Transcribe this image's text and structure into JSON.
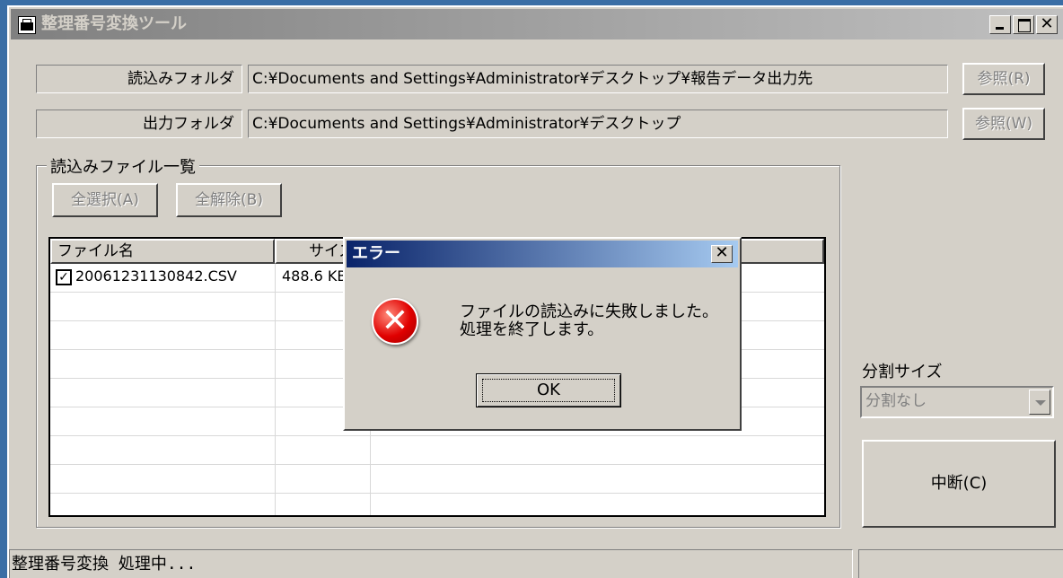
{
  "window": {
    "title": "整理番号変換ツール"
  },
  "read_folder": {
    "label": "読込みフォルダ",
    "path": "C:¥Documents and Settings¥Administrator¥デスクトップ¥報告データ出力先",
    "browse_label": "参照(R)"
  },
  "output_folder": {
    "label": "出力フォルダ",
    "path": "C:¥Documents and Settings¥Administrator¥デスクトップ",
    "browse_label": "参照(W)"
  },
  "file_list": {
    "group_title": "読込みファイル一覧",
    "select_all_label": "全選択(A)",
    "deselect_all_label": "全解除(B)",
    "columns": [
      "ファイル名",
      "サイズ"
    ],
    "rows": [
      {
        "checked": true,
        "name": "20061231130842.CSV",
        "size": "488.6 KB"
      }
    ]
  },
  "split": {
    "label": "分割サイズ",
    "selected": "分割なし"
  },
  "abort_label": "中断(C)",
  "status": {
    "text": "整理番号変換 処理中..."
  },
  "dialog": {
    "title": "エラー",
    "message_line1": "ファイルの読込みに失敗しました。",
    "message_line2": "処理を終了します。",
    "ok_label": "OK",
    "icon": "error-icon"
  }
}
